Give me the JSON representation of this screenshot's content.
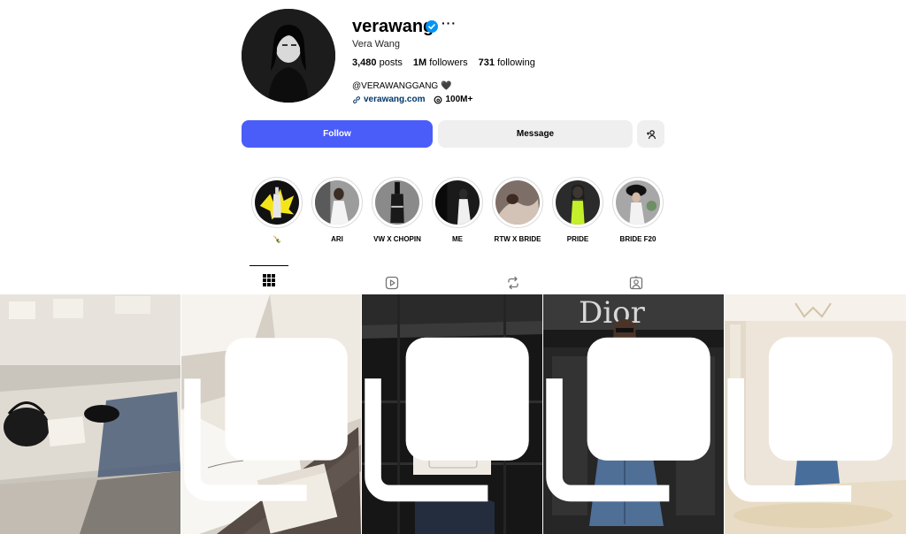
{
  "profile": {
    "username": "verawang",
    "full_name": "Vera Wang",
    "more_label": "···",
    "bio": "@VERAWANGGANG 🖤",
    "link": "verawang.com",
    "threads_count": "100M+"
  },
  "stats": {
    "posts_count": "3,480",
    "posts_label": "posts",
    "followers_count": "1M",
    "followers_label": "followers",
    "following_count": "731",
    "following_label": "following"
  },
  "actions": {
    "follow": "Follow",
    "message": "Message"
  },
  "highlights": [
    {
      "label": "🍾"
    },
    {
      "label": "ARI"
    },
    {
      "label": "VW X CHOPIN"
    },
    {
      "label": "ME"
    },
    {
      "label": "RTW X BRIDE"
    },
    {
      "label": "PRIDE"
    },
    {
      "label": "BRIDE F20"
    }
  ],
  "tabs": [
    {
      "icon": "grid-icon",
      "active": true
    },
    {
      "icon": "reels-icon",
      "active": false
    },
    {
      "icon": "reposts-icon",
      "active": false
    },
    {
      "icon": "tagged-icon",
      "active": false
    }
  ],
  "colors": {
    "follow_button": "#4a5df9",
    "secondary_button": "#efefef",
    "verified": "#0095f6",
    "link": "#00376b"
  }
}
